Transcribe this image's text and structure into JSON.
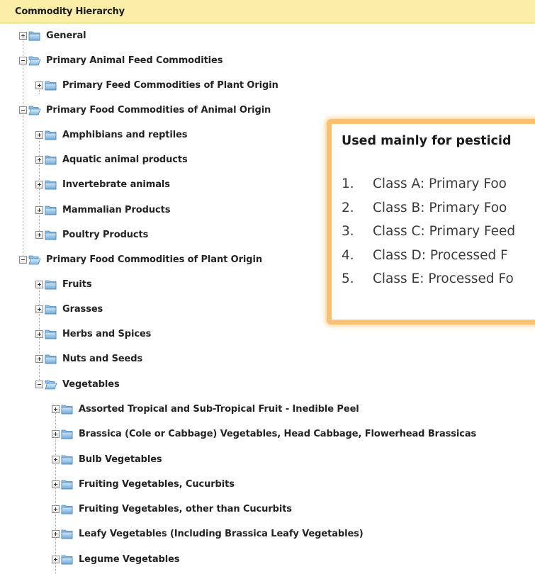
{
  "header": {
    "title": "Commodity Hierarchy"
  },
  "tree": {
    "nodes": [
      {
        "label": "General",
        "expanded": false
      },
      {
        "label": "Primary Animal Feed Commodities",
        "expanded": true
      },
      {
        "label": "Primary Feed Commodities of Plant Origin",
        "expanded": false
      },
      {
        "label": "Primary Food Commodities of Animal Origin",
        "expanded": true
      },
      {
        "label": "Amphibians and reptiles",
        "expanded": false
      },
      {
        "label": "Aquatic animal products",
        "expanded": false
      },
      {
        "label": "Invertebrate animals",
        "expanded": false
      },
      {
        "label": "Mammalian Products",
        "expanded": false
      },
      {
        "label": "Poultry Products",
        "expanded": false
      },
      {
        "label": "Primary Food Commodities of Plant Origin",
        "expanded": true
      },
      {
        "label": "Fruits",
        "expanded": false
      },
      {
        "label": "Grasses",
        "expanded": false
      },
      {
        "label": "Herbs and Spices",
        "expanded": false
      },
      {
        "label": "Nuts and Seeds",
        "expanded": false
      },
      {
        "label": "Vegetables",
        "expanded": true
      },
      {
        "label": "Assorted Tropical and Sub-Tropical Fruit - Inedible Peel",
        "expanded": false
      },
      {
        "label": "Brassica (Cole or Cabbage) Vegetables, Head Cabbage, Flowerhead Brassicas",
        "expanded": false
      },
      {
        "label": "Bulb Vegetables",
        "expanded": false
      },
      {
        "label": "Fruiting Vegetables, Cucurbits",
        "expanded": false
      },
      {
        "label": "Fruiting Vegetables, other than Cucurbits",
        "expanded": false
      },
      {
        "label": "Leafy Vegetables (Including Brassica Leafy Vegetables)",
        "expanded": false
      },
      {
        "label": "Legume Vegetables",
        "expanded": false
      }
    ]
  },
  "callout": {
    "title": "Used mainly for pesticid",
    "items": [
      {
        "num": "1.",
        "text": "Class A: Primary Foo"
      },
      {
        "num": "2.",
        "text": "Class B: Primary Foo"
      },
      {
        "num": "3.",
        "text": "Class C: Primary Feed"
      },
      {
        "num": "4.",
        "text": "Class D: Processed F"
      },
      {
        "num": "5.",
        "text": "Class E: Processed Fo"
      }
    ]
  },
  "icons": {
    "expander_collapsed": "plus-box-icon",
    "expander_expanded": "minus-box-icon",
    "folder": "folder-icon"
  },
  "colors": {
    "header_bg": "#fbeea6",
    "callout_border": "#fbc170",
    "folder_blue": "#7fb6e0"
  }
}
